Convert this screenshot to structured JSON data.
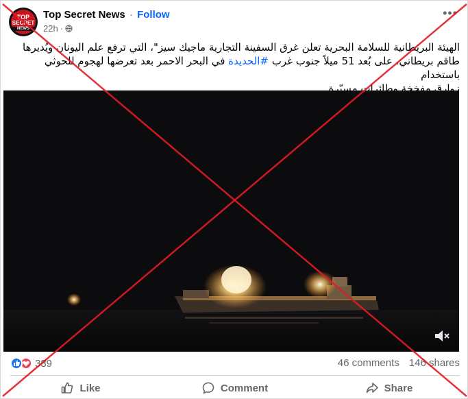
{
  "post": {
    "page_name": "Top Secret News",
    "separator": "·",
    "follow_label": "Follow",
    "time": "22h",
    "time_dot": "·",
    "privacy_icon": "globe-icon",
    "more_label": "•••",
    "avatar": {
      "line1": "TOP",
      "line2": "SECRET",
      "line3": "NEWS"
    },
    "text_line1": "الهيئة البريطانية للسلامة البحرية تعلن غرق السفينة التجارية ماجيك سيز\"، التي ترفع علم اليونان ويُديرها",
    "text_line2_a": "طاقم بريطاني، على بُعد 51 ميلاً جنوب غرب ",
    "hashtag": "#الحديدة",
    "text_line2_b": " في البحر الاحمر بعد تعرضها لهجوم للحوثي باستخدام",
    "text_line3": "زوارق مفخخة وطائرات مسيّرة."
  },
  "media": {
    "type": "video",
    "mute_icon": "volume-muted-icon"
  },
  "stats": {
    "reaction_icons": [
      "like-icon",
      "love-icon"
    ],
    "reaction_count": "389",
    "comments": "46 comments",
    "shares": "146 shares"
  },
  "actions": {
    "like": "Like",
    "comment": "Comment",
    "share": "Share"
  },
  "colors": {
    "accent": "#0866ff",
    "like": "#1877f2",
    "love": "#f33e58",
    "cross": "#e31b23"
  }
}
